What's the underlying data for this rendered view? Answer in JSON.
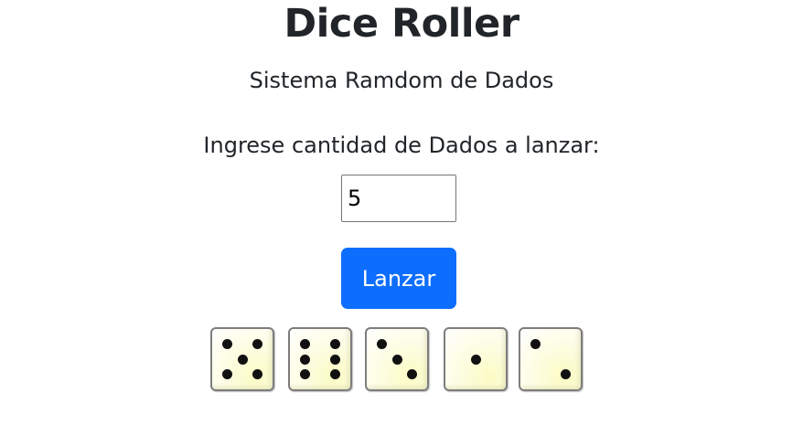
{
  "header": {
    "title": "Dice Roller",
    "subtitle": "Sistema Ramdom de Dados"
  },
  "form": {
    "quantity_label": "Ingrese cantidad de Dados a lanzar:",
    "quantity_value": "5",
    "roll_button_label": "Lanzar"
  },
  "dice": [
    {
      "value": 5
    },
    {
      "value": 6
    },
    {
      "value": 3
    },
    {
      "value": 1
    },
    {
      "value": 2
    }
  ],
  "colors": {
    "button": "#0d6efd",
    "button_text": "#ffffff",
    "die_face": "#fdfde2",
    "pip": "#111111"
  }
}
